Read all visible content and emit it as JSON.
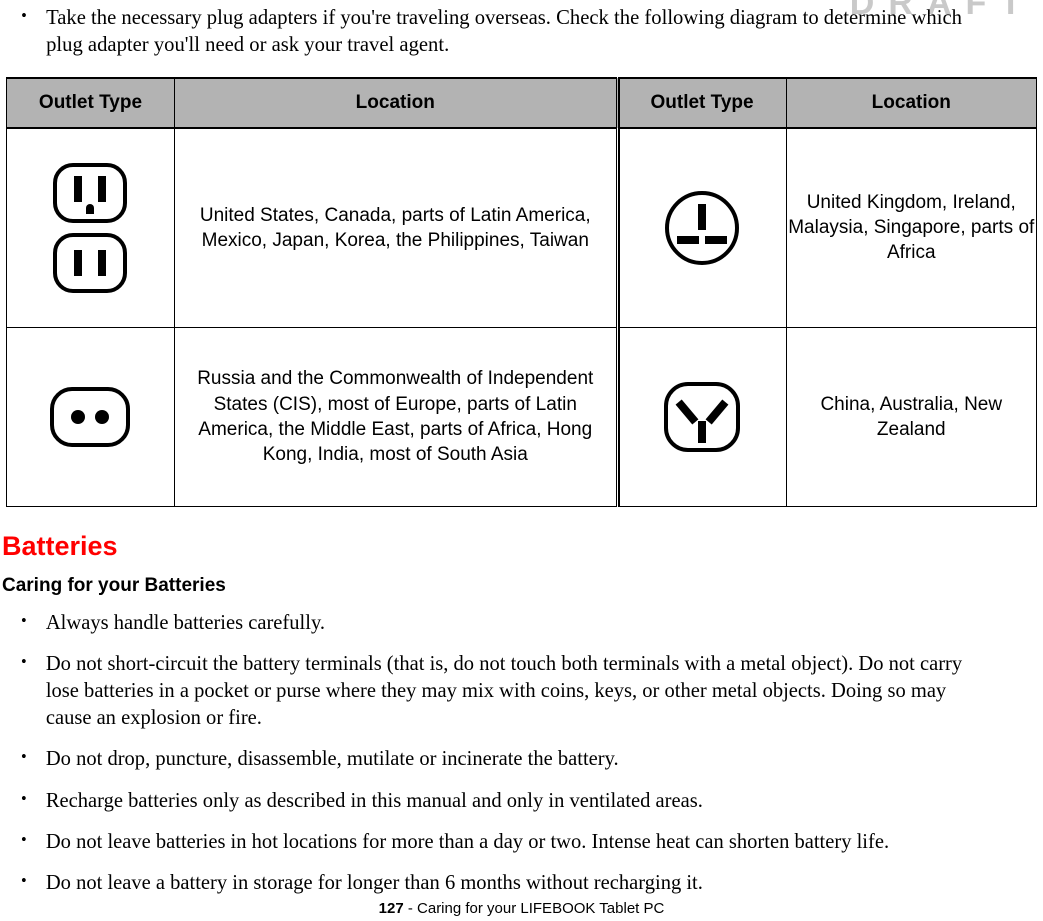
{
  "watermark": {
    "text": "DRAFT"
  },
  "intro": {
    "bullet_glyph": "•",
    "items": [
      "Take the necessary plug adapters if you're traveling overseas. Check the following diagram to determine which plug adapter you'll need or ask your travel agent."
    ]
  },
  "outlet_table": {
    "headers": [
      "Outlet Type",
      "Location",
      "Outlet Type",
      "Location"
    ],
    "header_bg": "#b3b3b3",
    "rows": [
      {
        "left_icon": "us-outlet-icon",
        "left_location": "United States, Canada, parts of Latin America, Mexico, Japan, Korea, the Philippines, Taiwan",
        "right_icon": "uk-outlet-icon",
        "right_location": "United Kingdom, Ireland, Malaysia, Singapore, parts of Africa"
      },
      {
        "left_icon": "europlug-outlet-icon",
        "left_location": "Russia and the Commonwealth of Independent States (CIS), most of Europe, parts of Latin America, the Middle East, parts of Africa, Hong Kong, India, most of South Asia",
        "right_icon": "australia-outlet-icon",
        "right_location": "China, Australia, New Zealand"
      }
    ]
  },
  "batteries": {
    "heading": "Batteries",
    "heading_color": "#ff0000",
    "subheading": "Caring for your Batteries",
    "bullet_glyph": "•",
    "items": [
      "Always handle batteries carefully.",
      "Do not short-circuit the battery terminals (that is, do not touch both terminals with a metal object). Do not carry lose batteries in a pocket or purse where they may mix with coins, keys, or other metal objects. Doing so may cause an explosion or fire.",
      "Do not drop, puncture, disassemble, mutilate or incinerate the battery.",
      "Recharge batteries only as described in this manual and only in ventilated areas.",
      "Do not leave batteries in hot locations for more than a day or two. Intense heat can shorten battery life.",
      "Do not leave a battery in storage for longer than 6 months without recharging it."
    ]
  },
  "footer": {
    "page_number": "127",
    "separator": " - ",
    "title": "Caring for your LIFEBOOK Tablet PC"
  }
}
